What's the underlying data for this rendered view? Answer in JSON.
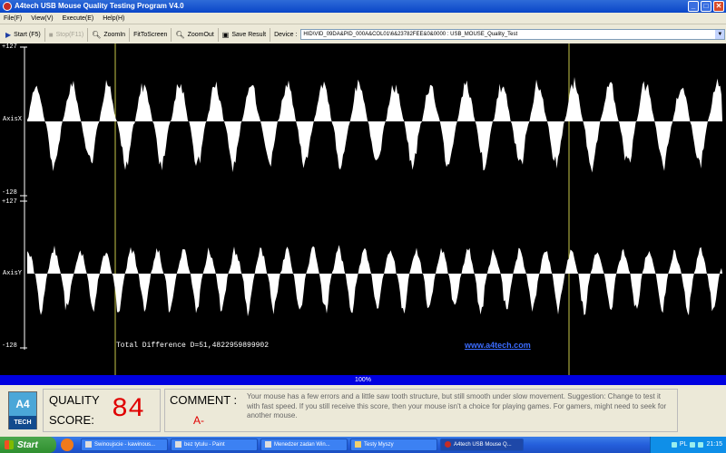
{
  "window": {
    "title": "A4tech USB Mouse Quality Testing Program V4.0"
  },
  "menu": [
    "File(F)",
    "View(V)",
    "Execute(E)",
    "Help(H)"
  ],
  "toolbar": {
    "start": "Start (F5)",
    "stop": "Stop(F11)",
    "zoom_in": "ZoomIn",
    "fit_to_screen": "FitToScreen",
    "zoom_out": "ZoomOut",
    "save_result": "Save Result",
    "device_label": "Device :",
    "device_value": "HID\\VID_09DA&PID_000A&COL01\\6&23782FEE&0&0000 :  USB_MOUSE_Quality_Test"
  },
  "plot": {
    "top_max": "+127",
    "top_axis": "AxisX",
    "top_min": "-128",
    "bottom_max": "+127",
    "bottom_axis": "AxisY",
    "bottom_min": "-128",
    "total_difference": "Total Difference D=51,4822959899902",
    "url": "www.a4tech.com"
  },
  "progress": {
    "text": "100%",
    "value": 1.0
  },
  "result": {
    "quality_label": "QUALITY",
    "score_label": "SCORE:",
    "score": "84",
    "comment_label": "COMMENT :",
    "grade": "A-",
    "comment": "Your mouse has a few errors and a little saw tooth structure, but still smooth under slow movement.  Suggestion:  Change to test it with fast speed.  If you still receive this score, then your mouse isn't a choice for playing games.  For gamers, might need to seek for another mouse."
  },
  "logo": {
    "text_top": "A4",
    "text_bottom": "TECH"
  },
  "taskbar": {
    "start": "Start",
    "tasks": [
      {
        "label": "Swinoujscie - kawinous...",
        "active": false
      },
      {
        "label": "bez tytulu - Paint",
        "active": false
      },
      {
        "label": "Menedzer zadan Win...",
        "active": false
      },
      {
        "label": "Testy Myszy",
        "active": false
      },
      {
        "label": "A4tech USB Mouse Q...",
        "active": true
      }
    ],
    "tray_lang": "PL",
    "clock": "21:15"
  },
  "colors": {
    "plot_bg": "#000000",
    "wave": "#ffffff",
    "marker": "#c8c84a",
    "progress": "#0000e0",
    "score": "#e00000",
    "url": "#3b6cff"
  }
}
